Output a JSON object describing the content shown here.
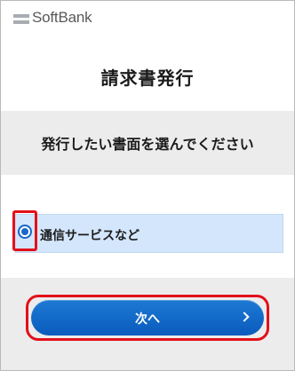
{
  "header": {
    "brand": "SoftBank",
    "logo_icon": "softbank-logo-bars"
  },
  "title": "請求書発行",
  "section_heading": "発行したい書面を選んでください",
  "options": [
    {
      "label": "通信サービスなど",
      "selected": true
    }
  ],
  "next_button": {
    "label": "次へ",
    "icon": "chevron-right-icon"
  },
  "colors": {
    "accent": "#1a67c9",
    "button": "#0f66c6",
    "highlight": "#e3101a",
    "option_bg": "#d3e6fb",
    "band_bg": "#ececec"
  }
}
